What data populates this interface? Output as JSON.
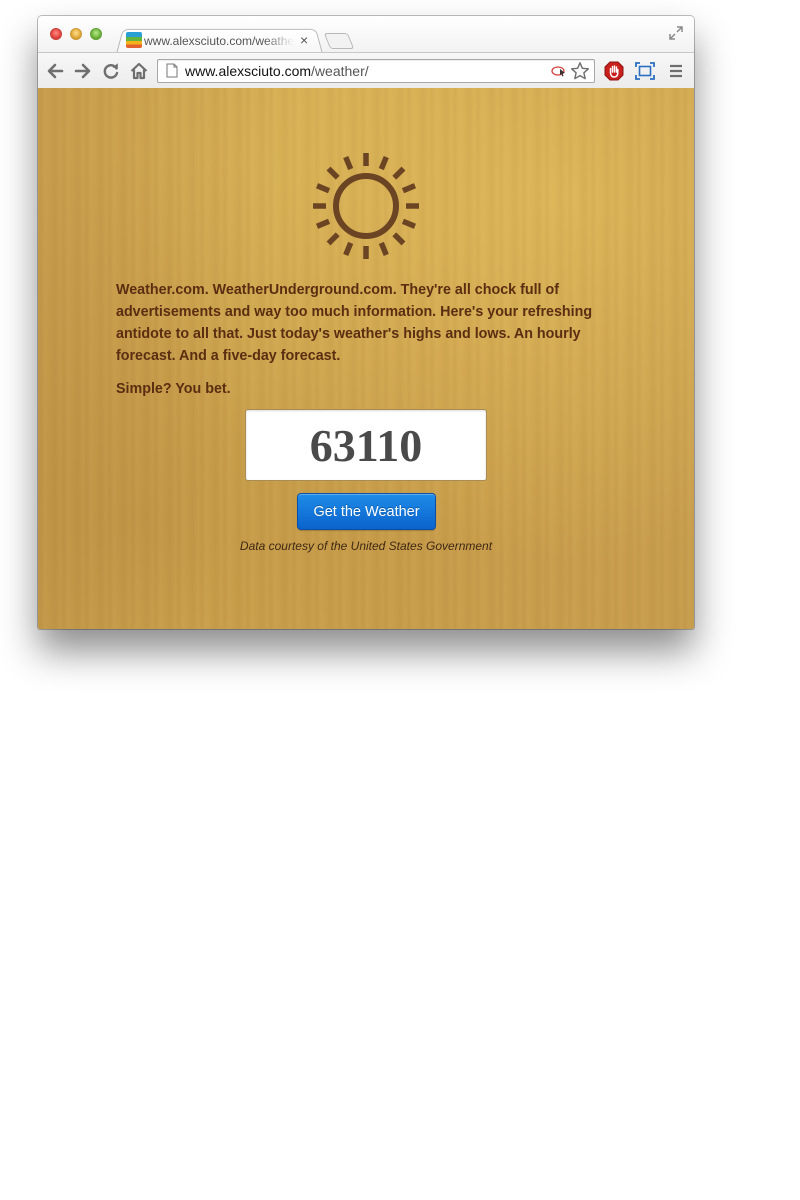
{
  "browser": {
    "tab": {
      "title": "www.alexsciuto.com/weather/",
      "close_glyph": "×"
    },
    "url": {
      "host": "www.alexsciuto.com",
      "path": "/weather/"
    },
    "icons": {
      "back": "arrow-left-icon",
      "forward": "arrow-right-icon",
      "reload": "reload-icon",
      "home": "home-icon",
      "bookmark": "star-icon",
      "extension_stop": "stop-hand-icon",
      "extension_screenshot": "screen-capture-icon",
      "menu": "hamburger-menu-icon",
      "fullscreen": "fullscreen-arrows-icon"
    }
  },
  "page": {
    "logo_icon": "sun-icon",
    "intro": "Weather.com. WeatherUnderground.com. They're all chock full of advertisements and way too much information. Here's your refreshing antidote to all that. Just today's weather's highs and lows. An hourly forecast. And a five-day forecast.",
    "tagline": "Simple? You bet.",
    "zip_value": "63110",
    "button_label": "Get the Weather",
    "credit": "Data courtesy of the United States Government"
  },
  "colors": {
    "background": "#cfa650",
    "text": "#5b2e12",
    "button": "#0b6fd8",
    "sun": "#6b4424"
  }
}
